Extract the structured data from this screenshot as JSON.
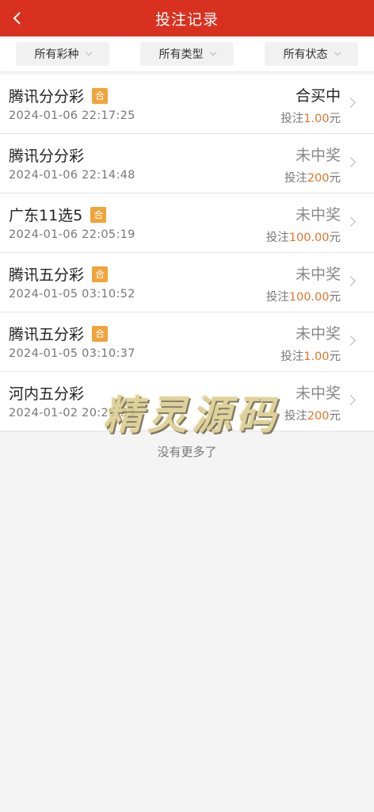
{
  "header": {
    "title": "投注记录",
    "back_icon": "chevron-left-icon"
  },
  "filters": [
    {
      "label": "所有彩种"
    },
    {
      "label": "所有类型"
    },
    {
      "label": "所有状态"
    }
  ],
  "records": [
    {
      "name": "腾讯分分彩",
      "badge": "合",
      "time": "2024-01-06 22:17:25",
      "status": "合买中",
      "bet_prefix": "投注",
      "amount": "1.00",
      "unit": "元"
    },
    {
      "name": "腾讯分分彩",
      "badge": "",
      "time": "2024-01-06 22:14:48",
      "status": "未中奖",
      "bet_prefix": "投注",
      "amount": "200",
      "unit": "元"
    },
    {
      "name": "广东11选5",
      "badge": "合",
      "time": "2024-01-06 22:05:19",
      "status": "未中奖",
      "bet_prefix": "投注",
      "amount": "100.00",
      "unit": "元"
    },
    {
      "name": "腾讯五分彩",
      "badge": "合",
      "time": "2024-01-05 03:10:52",
      "status": "未中奖",
      "bet_prefix": "投注",
      "amount": "100.00",
      "unit": "元"
    },
    {
      "name": "腾讯五分彩",
      "badge": "合",
      "time": "2024-01-05 03:10:37",
      "status": "未中奖",
      "bet_prefix": "投注",
      "amount": "1.00",
      "unit": "元"
    },
    {
      "name": "河内五分彩",
      "badge": "",
      "time": "2024-01-02 20:25:33",
      "status": "未中奖",
      "bet_prefix": "投注",
      "amount": "200",
      "unit": "元"
    }
  ],
  "footer": {
    "no_more": "没有更多了"
  },
  "watermark": "精灵源码",
  "colors": {
    "header": "#d9311f",
    "badge": "#f0a43a",
    "amount": "#e0742b"
  }
}
